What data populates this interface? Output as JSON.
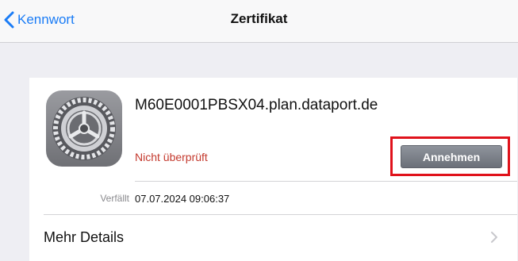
{
  "navbar": {
    "back_label": "Kennwort",
    "title": "Zertifikat"
  },
  "certificate": {
    "icon": "settings-gear-icon",
    "name": "M60E0001PBSX04.plan.dataport.de",
    "status": "Nicht überprüft",
    "accept_label": "Annehmen",
    "expires_label": "Verfällt",
    "expires_value": "07.07.2024 09:06:37"
  },
  "more": {
    "label": "Mehr Details"
  },
  "colors": {
    "accent": "#1a7cf6",
    "status": "#c4392d",
    "highlight": "#e0121b",
    "button": "#7c818a"
  }
}
